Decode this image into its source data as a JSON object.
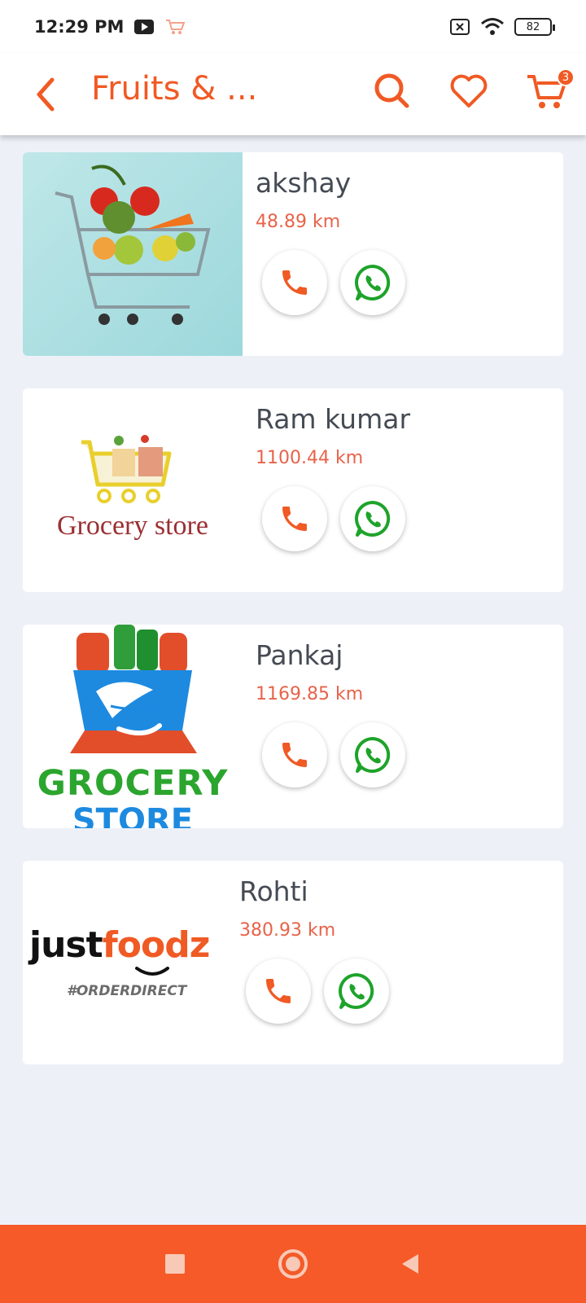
{
  "status_bar": {
    "time": "12:29 PM",
    "battery": "82",
    "icons": [
      "youtube-icon",
      "cart-notification-icon",
      "sim-off-icon",
      "wifi-icon",
      "battery-icon"
    ]
  },
  "app_bar": {
    "title": "Fruits & ...",
    "cart_badge": "3",
    "accent_color": "#f05a24"
  },
  "stores": [
    {
      "name": "akshay",
      "distance": "48.89 km",
      "thumb": "shopping-cart-vegetables"
    },
    {
      "name": "Ram kumar",
      "distance": "1100.44 km",
      "thumb": "grocery-store-logo",
      "thumb_text": "Grocery store"
    },
    {
      "name": "Pankaj",
      "distance": "1169.85 km",
      "thumb": "grocery-store-bag-logo",
      "thumb_text": [
        "GROCERY",
        "STORE"
      ]
    },
    {
      "name": "Rohti",
      "distance": "380.93 km",
      "thumb": "justfoodz-logo",
      "thumb_text": [
        "justfoodz",
        "#ORDERDIRECT"
      ]
    }
  ],
  "nav": {
    "color": "#f55a28",
    "icons": [
      "recents-square-icon",
      "home-circle-icon",
      "back-triangle-icon"
    ]
  }
}
